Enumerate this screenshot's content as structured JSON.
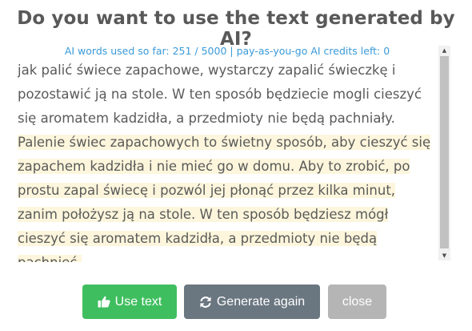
{
  "dialog": {
    "title": "Do you want to use the text generated by AI?",
    "usage": "AI words used so far: 251 / 5000 | pay-as-you-go AI credits left: 0"
  },
  "text": {
    "plain": "jak palić świece zapachowe, wystarczy zapalić świeczkę i pozostawić ją na stole. W ten sposób będziecie mogli cieszyć się aromatem kadzidła, a przedmioty nie będą pachniały.",
    "highlighted": "Palenie świec zapachowych to świetny sposób, aby cieszyć się zapachem kadzidła i nie mieć go w domu. Aby to zrobić, po prostu zapal świecę i pozwól jej płonąć przez kilka minut, zanim położysz ją na stole. W ten sposób będziesz mógł cieszyć się aromatem kadzidła, a przedmioty nie będą pachnieć."
  },
  "buttons": {
    "use_text": "Use text",
    "generate_again": "Generate again",
    "close": "close"
  },
  "icons": {
    "use_text": "thumbs-up-icon",
    "generate_again": "refresh-icon"
  },
  "colors": {
    "use_text": "#3fbe5f",
    "generate_again": "#6a7680",
    "close": "#b5b5b5",
    "usage_text": "#3a9ad9",
    "highlight": "#fdf6dc"
  }
}
